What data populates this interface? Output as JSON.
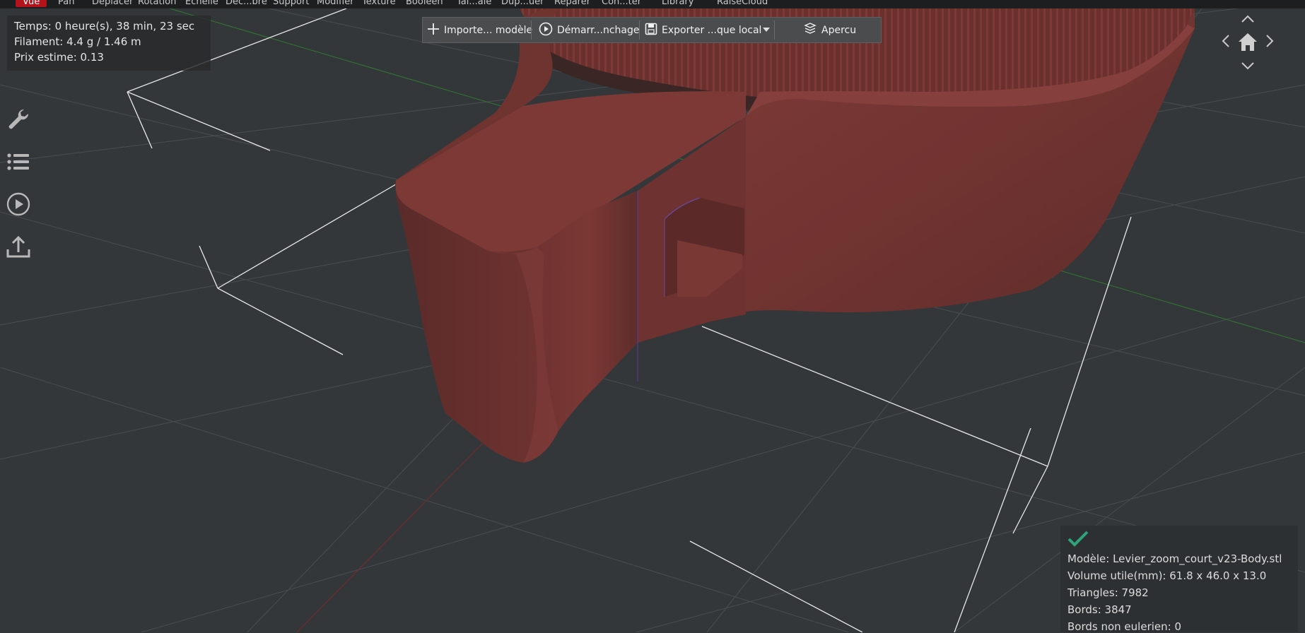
{
  "menu": {
    "items": [
      "Vue",
      "Pan",
      "Deplacer",
      "Rotation",
      "Echelle",
      "Dec...bre",
      "Support",
      "Modifier",
      "Texture",
      "Booleen",
      "Tai...ale",
      "Dup...uer",
      "Reparer",
      "Con...ter",
      "Library",
      "RaiseCloud"
    ],
    "active": "Vue"
  },
  "stats": {
    "time": "Temps: 0 heure(s), 38 min, 23 sec",
    "filament": "Filament: 4.4 g / 1.46 m",
    "price": "Prix estime: 0.13"
  },
  "toolbar": {
    "import_label": "Importe... modèle",
    "start_label": "Démarr...nchage",
    "export_label": "Exporter ...que local",
    "preview_label": "Apercu"
  },
  "left_tools": {
    "icons": [
      "wrench-icon",
      "list-icon",
      "play-circle-icon",
      "upload-icon"
    ]
  },
  "model_info": {
    "model": "Modèle: Levier_zoom_court_v23-Body.stl",
    "volume": "Volume utile(mm): 61.8 x 46.0 x 13.0",
    "triangles": "Triangles: 7982",
    "edges": "Bords: 3847",
    "non_eulerian": "Bords non eulerien: 0"
  },
  "colors": {
    "background": "#34373a",
    "model": "#8a3e3b",
    "accent_active": "#b3141c",
    "check": "#2fa37a"
  }
}
